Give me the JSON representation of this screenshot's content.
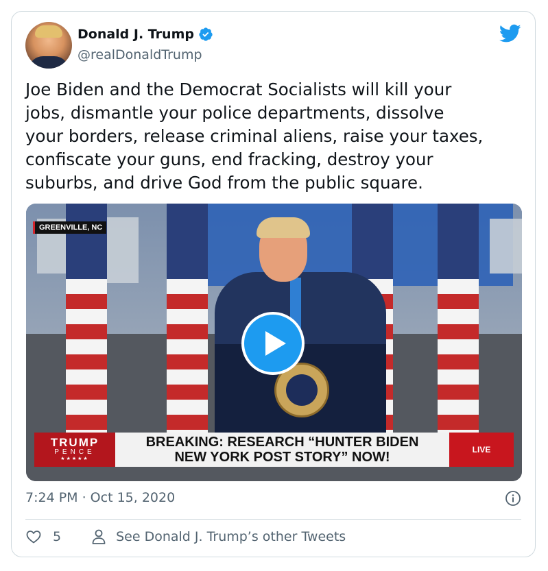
{
  "tweet": {
    "author_name": "Donald J. Trump",
    "handle": "@realDonaldTrump",
    "text": "Joe Biden and the Democrat Socialists will kill your\njobs, dismantle your police departments, dissolve\nyour borders, release criminal aliens, raise your taxes,\nconfiscate your guns, end fracking, destroy your\nsuburbs, and drive God from the public square.",
    "timestamp": "7:24 PM · Oct 15, 2020",
    "like_count": "5",
    "other_tweets_label": "See Donald J. Trump’s other Tweets"
  },
  "media": {
    "location": "GREENVILLE, NC",
    "logo_top": "TRUMP",
    "logo_bottom": "PENCE",
    "logo_stars": "★★★★★",
    "headline_line1": "BREAKING: RESEARCH “HUNTER BIDEN",
    "headline_line2": "NEW YORK POST STORY” NOW!",
    "live_label": "LIVE"
  },
  "icons": {
    "verified": "verified-badge-icon",
    "twitter": "twitter-bird-icon",
    "play": "play-icon",
    "info": "info-icon",
    "like": "heart-icon",
    "profile": "person-icon"
  },
  "colors": {
    "accent": "#1d9bf0",
    "text": "#0f1419",
    "secondary_text": "#536471",
    "border": "#cfd9de"
  }
}
